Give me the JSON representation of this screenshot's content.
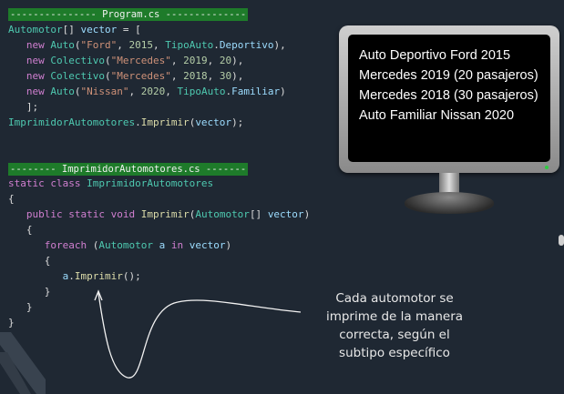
{
  "program": {
    "header": "--------------- Program.cs --------------",
    "lines": [
      [
        [
          "ty",
          "Automotor"
        ],
        [
          "pl",
          "[] "
        ],
        [
          "vr",
          "vector"
        ],
        [
          "pl",
          " = ["
        ]
      ],
      [
        [
          "pl",
          "   "
        ],
        [
          "kw",
          "new "
        ],
        [
          "ty",
          "Auto"
        ],
        [
          "pl",
          "("
        ],
        [
          "st",
          "\"Ford\""
        ],
        [
          "pl",
          ", "
        ],
        [
          "nm",
          "2015"
        ],
        [
          "pl",
          ", "
        ],
        [
          "ty",
          "TipoAuto"
        ],
        [
          "pl",
          "."
        ],
        [
          "vr",
          "Deportivo"
        ],
        [
          "pl",
          "),"
        ]
      ],
      [
        [
          "pl",
          "   "
        ],
        [
          "kw",
          "new "
        ],
        [
          "ty",
          "Colectivo"
        ],
        [
          "pl",
          "("
        ],
        [
          "st",
          "\"Mercedes\""
        ],
        [
          "pl",
          ", "
        ],
        [
          "nm",
          "2019"
        ],
        [
          "pl",
          ", "
        ],
        [
          "nm",
          "20"
        ],
        [
          "pl",
          "),"
        ]
      ],
      [
        [
          "pl",
          "   "
        ],
        [
          "kw",
          "new "
        ],
        [
          "ty",
          "Colectivo"
        ],
        [
          "pl",
          "("
        ],
        [
          "st",
          "\"Mercedes\""
        ],
        [
          "pl",
          ", "
        ],
        [
          "nm",
          "2018"
        ],
        [
          "pl",
          ", "
        ],
        [
          "nm",
          "30"
        ],
        [
          "pl",
          "),"
        ]
      ],
      [
        [
          "pl",
          "   "
        ],
        [
          "kw",
          "new "
        ],
        [
          "ty",
          "Auto"
        ],
        [
          "pl",
          "("
        ],
        [
          "st",
          "\"Nissan\""
        ],
        [
          "pl",
          ", "
        ],
        [
          "nm",
          "2020"
        ],
        [
          "pl",
          ", "
        ],
        [
          "ty",
          "TipoAuto"
        ],
        [
          "pl",
          "."
        ],
        [
          "vr",
          "Familiar"
        ],
        [
          "pl",
          ")"
        ]
      ],
      [
        [
          "pl",
          "   ];"
        ]
      ],
      [
        [
          "ty",
          "ImprimidorAutomotores"
        ],
        [
          "pl",
          "."
        ],
        [
          "fn",
          "Imprimir"
        ],
        [
          "pl",
          "("
        ],
        [
          "vr",
          "vector"
        ],
        [
          "pl",
          ");"
        ]
      ]
    ]
  },
  "printer": {
    "header": "-------- ImprimidorAutomotores.cs -------",
    "lines": [
      [
        [
          "kw",
          "static class "
        ],
        [
          "ty",
          "ImprimidorAutomotores"
        ]
      ],
      [
        [
          "pl",
          "{"
        ]
      ],
      [
        [
          "pl",
          "   "
        ],
        [
          "kw",
          "public static void "
        ],
        [
          "fn",
          "Imprimir"
        ],
        [
          "pl",
          "("
        ],
        [
          "ty",
          "Automotor"
        ],
        [
          "pl",
          "[] "
        ],
        [
          "vr",
          "vector"
        ],
        [
          "pl",
          ")"
        ]
      ],
      [
        [
          "pl",
          "   {"
        ]
      ],
      [
        [
          "pl",
          "      "
        ],
        [
          "kw",
          "foreach "
        ],
        [
          "pl",
          "("
        ],
        [
          "ty",
          "Automotor "
        ],
        [
          "vr",
          "a "
        ],
        [
          "kw",
          "in "
        ],
        [
          "vr",
          "vector"
        ],
        [
          "pl",
          ")"
        ]
      ],
      [
        [
          "pl",
          "      {"
        ]
      ],
      [
        [
          "pl",
          "         "
        ],
        [
          "vr",
          "a"
        ],
        [
          "pl",
          "."
        ],
        [
          "fn",
          "Imprimir"
        ],
        [
          "pl",
          "();"
        ]
      ],
      [
        [
          "pl",
          "      }"
        ]
      ],
      [
        [
          "pl",
          "   }"
        ]
      ],
      [
        [
          "pl",
          "}"
        ]
      ]
    ]
  },
  "monitor": {
    "output_lines": [
      "Auto Deportivo Ford 2015",
      "Mercedes 2019 (20 pasajeros)",
      "Mercedes 2018 (30 pasajeros)",
      "Auto Familiar Nissan 2020"
    ]
  },
  "annotation": {
    "caption_lines": [
      "Cada automotor se",
      "imprime de la manera",
      "correcta, según el",
      "subtipo específico"
    ]
  },
  "colors": {
    "background": "#1f2833",
    "header_bar": "#1e7b2a",
    "keyword": "#d07fd0",
    "type": "#4ec9b0",
    "string": "#ce9178",
    "number": "#b5cea8",
    "variable": "#9cdcfe",
    "function": "#dcdcaa"
  }
}
